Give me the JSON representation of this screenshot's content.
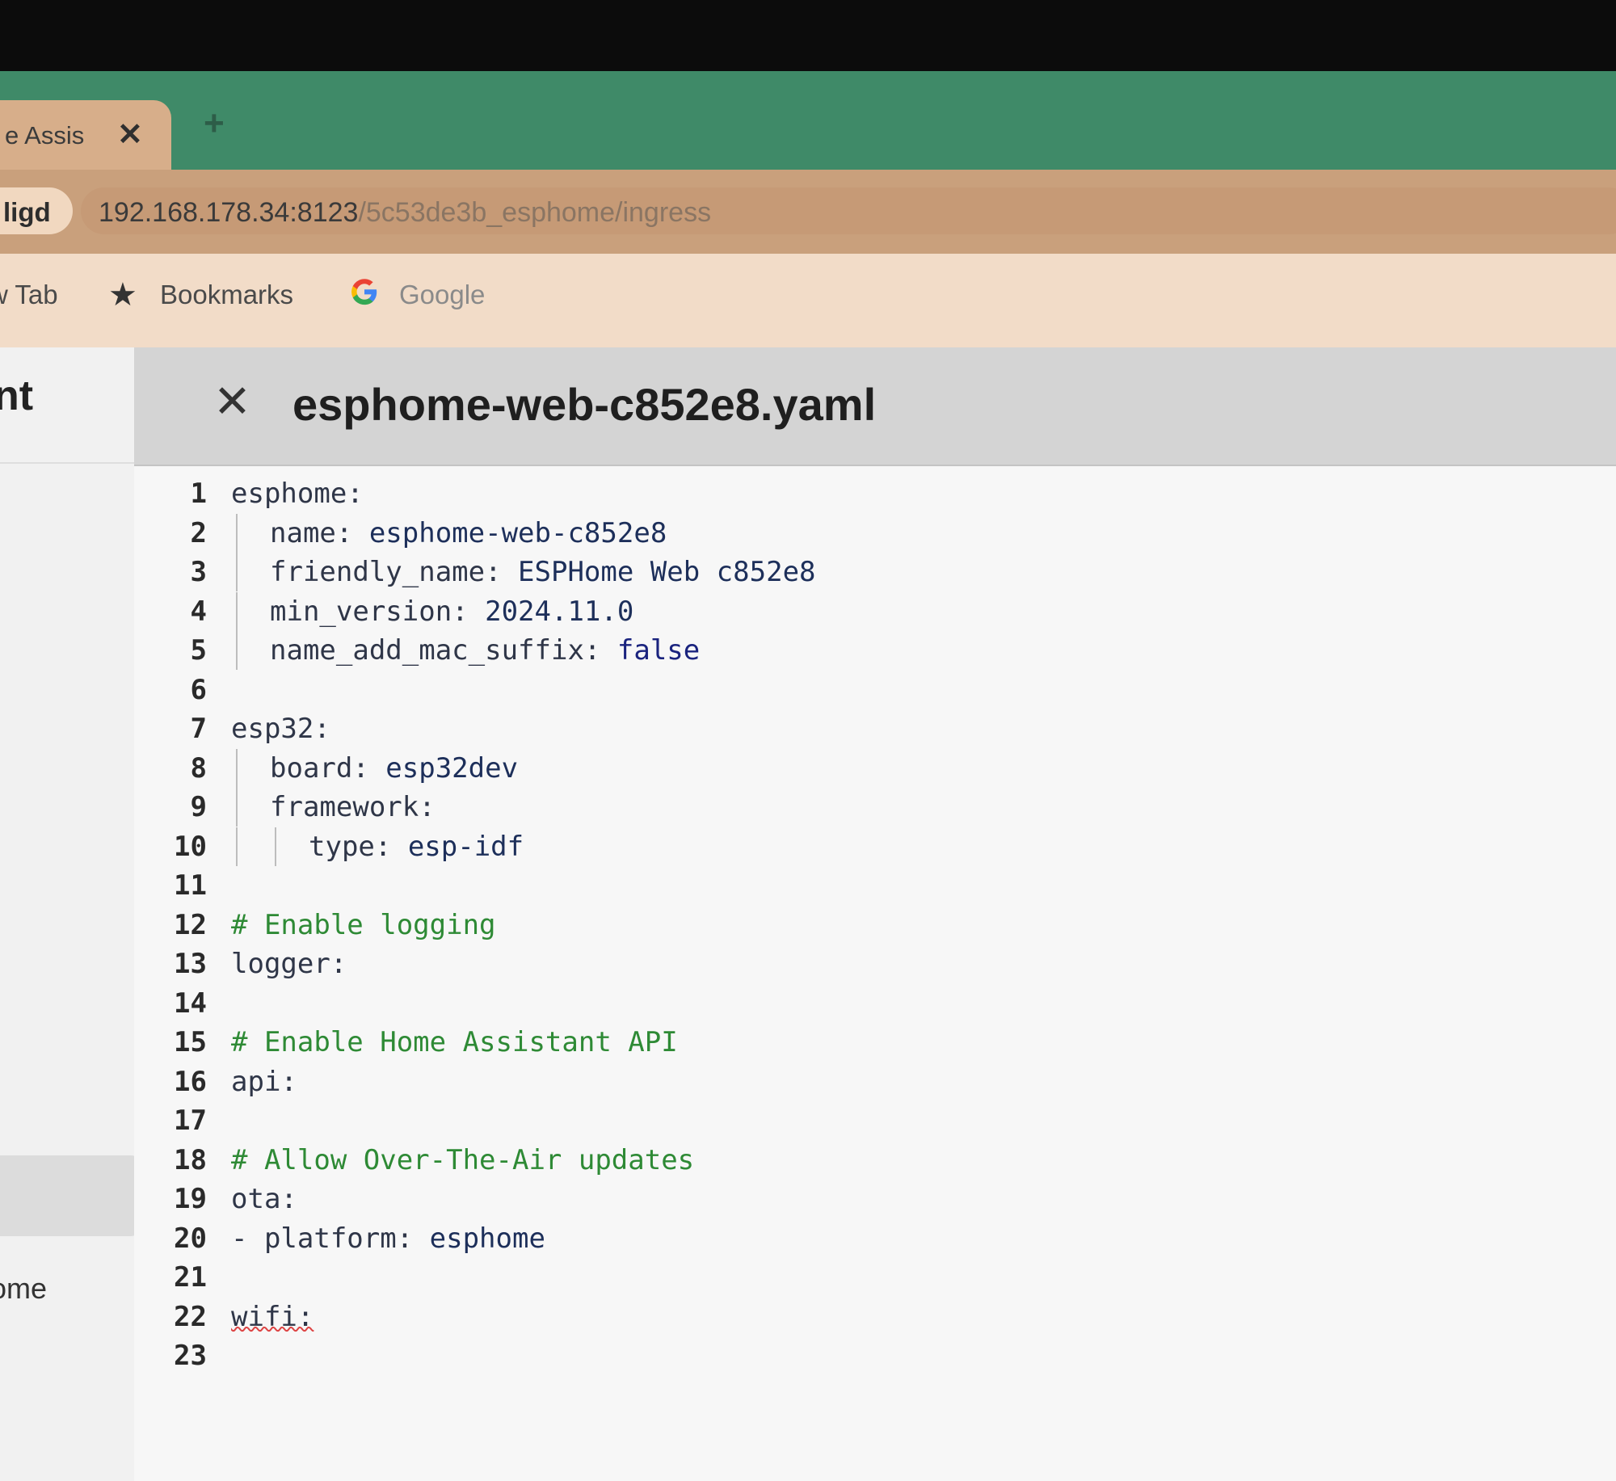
{
  "browser": {
    "tab_title": "e Assis",
    "tab_close": "✕",
    "new_tab": "+",
    "profile_label": "ligd",
    "url_main": "192.168.178.34:8123",
    "url_path": "/5c53de3b_esphome/ingress",
    "bookmarks": {
      "new_tab": "w Tab",
      "bookmarks_label": "Bookmarks",
      "google_label": "Google"
    }
  },
  "sidebar": {
    "title": "nt",
    "item": "ome"
  },
  "editor": {
    "close_icon": "✕",
    "filename": "esphome-web-c852e8.yaml",
    "lines": [
      {
        "n": "1",
        "indent": 0,
        "key": "esphome:",
        "val": "",
        "type": "key"
      },
      {
        "n": "2",
        "indent": 1,
        "key": "name:",
        "val": "esphome-web-c852e8",
        "type": "kv"
      },
      {
        "n": "3",
        "indent": 1,
        "key": "friendly_name:",
        "val": "ESPHome Web c852e8",
        "type": "kv"
      },
      {
        "n": "4",
        "indent": 1,
        "key": "min_version:",
        "val": "2024.11.0",
        "type": "kv"
      },
      {
        "n": "5",
        "indent": 1,
        "key": "name_add_mac_suffix:",
        "val": "false",
        "type": "kw"
      },
      {
        "n": "6",
        "indent": 0,
        "key": "",
        "val": "",
        "type": "empty"
      },
      {
        "n": "7",
        "indent": 0,
        "key": "esp32:",
        "val": "",
        "type": "key"
      },
      {
        "n": "8",
        "indent": 1,
        "key": "board:",
        "val": "esp32dev",
        "type": "kv"
      },
      {
        "n": "9",
        "indent": 1,
        "key": "framework:",
        "val": "",
        "type": "key"
      },
      {
        "n": "10",
        "indent": 2,
        "key": "type:",
        "val": "esp-idf",
        "type": "kv"
      },
      {
        "n": "11",
        "indent": 0,
        "key": "",
        "val": "",
        "type": "empty"
      },
      {
        "n": "12",
        "indent": 0,
        "key": "# Enable logging",
        "val": "",
        "type": "comment"
      },
      {
        "n": "13",
        "indent": 0,
        "key": "logger:",
        "val": "",
        "type": "key"
      },
      {
        "n": "14",
        "indent": 0,
        "key": "",
        "val": "",
        "type": "empty"
      },
      {
        "n": "15",
        "indent": 0,
        "key": "# Enable Home Assistant API",
        "val": "",
        "type": "comment"
      },
      {
        "n": "16",
        "indent": 0,
        "key": "api:",
        "val": "",
        "type": "key"
      },
      {
        "n": "17",
        "indent": 0,
        "key": "",
        "val": "",
        "type": "empty"
      },
      {
        "n": "18",
        "indent": 0,
        "key": "# Allow Over-The-Air updates",
        "val": "",
        "type": "comment"
      },
      {
        "n": "19",
        "indent": 0,
        "key": "ota:",
        "val": "",
        "type": "key"
      },
      {
        "n": "20",
        "indent": 0,
        "key": "- platform:",
        "val": "esphome",
        "type": "kv"
      },
      {
        "n": "21",
        "indent": 0,
        "key": "",
        "val": "",
        "type": "empty"
      },
      {
        "n": "22",
        "indent": 0,
        "key": "wifi:",
        "val": "",
        "type": "error"
      },
      {
        "n": "23",
        "indent": 0,
        "key": "",
        "val": "",
        "type": "empty"
      }
    ]
  }
}
